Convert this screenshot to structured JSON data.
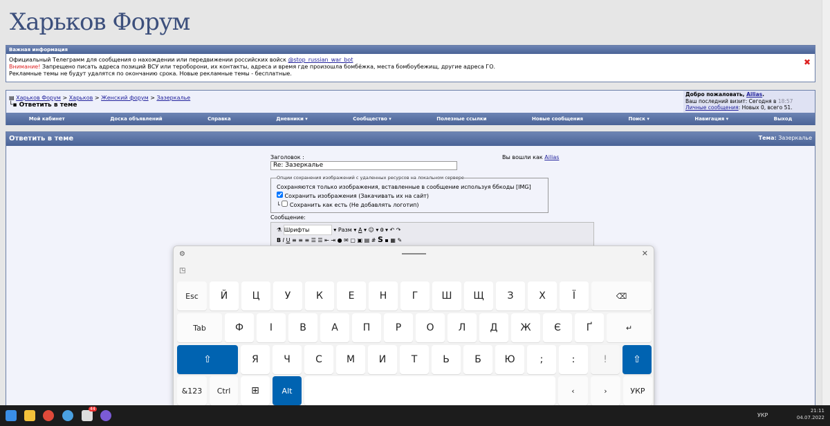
{
  "site": {
    "title": "Харьков Форум"
  },
  "info": {
    "header": "Важная информация",
    "line1": "Официальный Телеграмм для сообщения о нахождении или передвижении российских войск ",
    "bot": "@stop_russian_war_bot",
    "warn_label": "Внимание!",
    "line2": " Запрещено писать адреса позиций ВСУ или тероборони, их контакты, адреса и время где произошла бомбёжка, места бомбоубежищ, другие адреса ГО.",
    "line3": "Рекламные темы не будут удалятся по окончанию срока. Новые рекламные темы - бесплатные.",
    "close": "✖"
  },
  "breadcrumb": [
    "Харьков Форум",
    "Харьков",
    "Женский форум",
    "Зазеркалье"
  ],
  "sep": " > ",
  "page_title": "Ответить в теме",
  "welcome": {
    "greet": "Добро пожаловать, ",
    "user": "Ailias",
    "suffix": ".",
    "visit": "Ваш последний визит: Сегодня в ",
    "time": "18:57",
    "pm": "Личные сообщения",
    "pm_info": ": Новых 0, всего 51."
  },
  "nav": [
    "Мой кабинет",
    "Доска объявлений",
    "Справка",
    "Дневники ▾",
    "Сообщество ▾",
    "Полезные ссылки",
    "Новые сообщения",
    "Поиск ▾",
    "Навигация ▾",
    "Выход"
  ],
  "reply": {
    "header": "Ответить в теме",
    "topic_label": "Тема:",
    "topic": " Зазеркалье",
    "title_label": "Заголовок :",
    "title_value": "Re: Зазеркалье",
    "logged_as": "Вы вошли как ",
    "legend": "Опции сохранения изображений с удаленных ресурсов на локальном сервере",
    "note": "Сохраняются только изображения, вставленные в сообщение используя ббкоды [IMG]",
    "opt1": "Сохранить изображения (Закачивать их на сайт)",
    "opt2": "Сохранить как есть (Не добавлять логотип)",
    "msg_label": "Сообщение:",
    "font": "Шрифты",
    "size": "Разм"
  },
  "keyboard": {
    "row1": [
      "Esc",
      "Й",
      "Ц",
      "У",
      "К",
      "Е",
      "Н",
      "Г",
      "Ш",
      "Щ",
      "З",
      "Х",
      "Ї",
      "⌫"
    ],
    "row2": [
      "Tab",
      "Ф",
      "І",
      "В",
      "А",
      "П",
      "Р",
      "О",
      "Л",
      "Д",
      "Ж",
      "Є",
      "Ґ",
      "↵"
    ],
    "row3": [
      "⇧",
      "Я",
      "Ч",
      "С",
      "М",
      "И",
      "Т",
      "Ь",
      "Б",
      "Ю",
      ";",
      ":",
      "!",
      "⇧"
    ],
    "row4": [
      "&123",
      "Ctrl",
      "⊞",
      "Alt",
      " ",
      "‹",
      "›",
      "УКР"
    ],
    "accent": "#0063b1"
  },
  "taskbar": {
    "lang": "УКР",
    "time": "21:11",
    "date": "04.07.2022",
    "badge": "44"
  }
}
